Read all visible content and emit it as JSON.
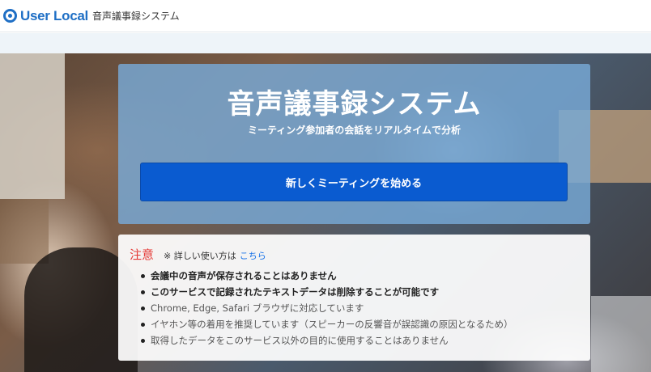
{
  "header": {
    "brand": "User Local",
    "title": "音声議事録システム"
  },
  "hero": {
    "title": "音声議事録システム",
    "subtitle": "ミーティング参加者の会話をリアルタイムで分析",
    "start_button": "新しくミーティングを始める",
    "accent": "#0a5bd0"
  },
  "notice": {
    "title": "注意",
    "hint": "※ 詳しい使い方は",
    "link": "こちら",
    "items": [
      {
        "text": "会議中の音声が保存されることはありません",
        "emphasis": true
      },
      {
        "text": "このサービスで記録されたテキストデータは削除することが可能です",
        "emphasis": true
      },
      {
        "text": "Chrome, Edge, Safari ブラウザに対応しています",
        "emphasis": false
      },
      {
        "text": "イヤホン等の着用を推奨しています（スピーカーの反響音が誤認識の原因となるため）",
        "emphasis": false
      },
      {
        "text": "取得したデータをこのサービス以外の目的に使用することはありません",
        "emphasis": false
      }
    ],
    "title_color": "#e53935"
  }
}
